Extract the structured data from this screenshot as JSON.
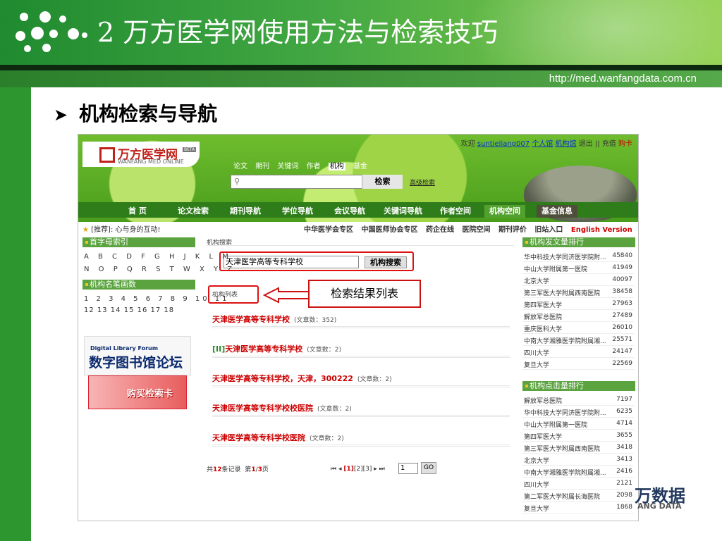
{
  "slide": {
    "title": "2  万方医学网使用方法与检索技巧",
    "url": "http://med.wanfangdata.com.cn",
    "bullet": "机构检索与导航"
  },
  "site": {
    "logo": "万方医学网",
    "logo_sub": "WANFANG MED ONLINE",
    "beta": "BETA",
    "welcome": {
      "greet": "欢迎",
      "user": "suntieliang007",
      "links": [
        "个人馆",
        "机构馆",
        "退出",
        "||",
        "充值"
      ],
      "cart": "购卡"
    },
    "search_tabs": [
      "论文",
      "期刊",
      "关键词",
      "作者",
      "机构",
      "基金"
    ],
    "active_tab": "机构",
    "search_button": "检索",
    "advanced": "高级检索",
    "nav": [
      "首 页",
      "论文检索",
      "期刊导航",
      "学位导航",
      "会议导航",
      "关键词导航",
      "作者空间",
      "机构空间",
      "基金信息"
    ],
    "recommend_label": "[推荐]:",
    "recommend_text": "心与身的互动!",
    "top_links": [
      "中华医学会专区",
      "中国医师协会专区",
      "药企在线",
      "医院空间",
      "期刊评价",
      "旧站入口"
    ],
    "english": "English Version"
  },
  "left": {
    "alpha_head": "首字母索引",
    "alpha_row1": "A B C D F G H J K L M",
    "alpha_row2": "N O P Q R S T W X Y Z",
    "stroke_head": "机构名笔画数",
    "stroke_row1": "1 2 3 4 5 6 7 8 9 10 11",
    "stroke_row2": "12 13 14 15 16 17 18",
    "forum_en": "Digital Library Forum",
    "forum_cn": "数字图书馆论坛",
    "card": "购买检索卡"
  },
  "middle": {
    "search_head": "机构搜索",
    "input_value": "天津医学高等专科学校",
    "search_button": "机构搜索",
    "list_head": "机构列表",
    "callout": "检索结果列表",
    "results": [
      {
        "prefix": "",
        "name": "天津医学高等专科学校",
        "count": "(文章数：352)"
      },
      {
        "prefix": "[II]",
        "name": "天津医学高等专科学校",
        "count": "(文章数：2)"
      },
      {
        "prefix": "",
        "name": "天津医学高等专科学校，天津，300222",
        "count": "(文章数：2)"
      },
      {
        "prefix": "",
        "name": "天津医学高等专科学校校医院",
        "count": "(文章数：2)"
      },
      {
        "prefix": "",
        "name": "天津医学高等专科学校医院",
        "count": "(文章数：2)"
      }
    ],
    "pager": {
      "total_pre": "共",
      "total": "12",
      "total_suf": "条记录",
      "page_pre": "第",
      "page": "1",
      "page_sep": "/",
      "pages": "3",
      "page_suf": "页",
      "nav_first": "⏮ ◂",
      "p1": "[1]",
      "p2": "[2]",
      "p3": "[3]",
      "nav_last": "▸ ⏭",
      "input": "1",
      "go": "GO"
    }
  },
  "right": {
    "pub_head": "机构发文量排行",
    "pub_rank": [
      {
        "name": "华中科技大学同济医学院附...",
        "value": "45840"
      },
      {
        "name": "中山大学附属第一医院",
        "value": "41949"
      },
      {
        "name": "北京大学",
        "value": "40097"
      },
      {
        "name": "第三军医大学附属西南医院",
        "value": "38458"
      },
      {
        "name": "第四军医大学",
        "value": "27963"
      },
      {
        "name": "解放军总医院",
        "value": "27489"
      },
      {
        "name": "重庆医科大学",
        "value": "26010"
      },
      {
        "name": "中南大学湘雅医学院附属湘...",
        "value": "25571"
      },
      {
        "name": "四川大学",
        "value": "24147"
      },
      {
        "name": "复旦大学",
        "value": "22569"
      }
    ],
    "click_head": "机构点击量排行",
    "click_rank": [
      {
        "name": "解放军总医院",
        "value": "7197"
      },
      {
        "name": "华中科技大学同济医学院附...",
        "value": "6235"
      },
      {
        "name": "中山大学附属第一医院",
        "value": "4714"
      },
      {
        "name": "第四军医大学",
        "value": "3655"
      },
      {
        "name": "第三军医大学附属西南医院",
        "value": "3418"
      },
      {
        "name": "北京大学",
        "value": "3413"
      },
      {
        "name": "中南大学湘雅医学院附属湘...",
        "value": "2416"
      },
      {
        "name": "四川大学",
        "value": "2121"
      },
      {
        "name": "第二军医大学附属长海医院",
        "value": "2098"
      },
      {
        "name": "复旦大学",
        "value": "1868"
      }
    ]
  },
  "watermark": {
    "a": "万数据",
    "b": "ANG DATA"
  },
  "colors": {
    "brand_green": "#2e962e",
    "highlight_red": "#dd1111",
    "link_red": "#cc0000"
  }
}
